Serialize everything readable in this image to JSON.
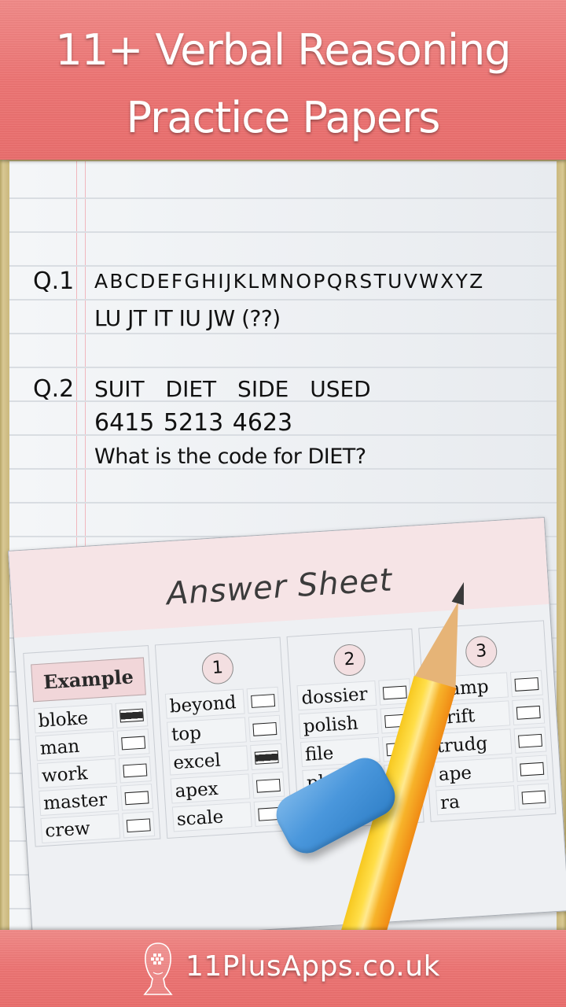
{
  "header": {
    "title_line1": "11+ Verbal Reasoning",
    "title_line2": "Practice Papers"
  },
  "questions": [
    {
      "label": "Q.1",
      "lines": [
        "ABCDEFGHIJKLMNOPQRSTUVWXYZ",
        "LU JT IT IU JW (??)"
      ]
    },
    {
      "label": "Q.2",
      "lines": [
        "SUIT DIET SIDE USED",
        "6415 5213 4623",
        "What is the code for DIET?"
      ]
    }
  ],
  "answer_sheet": {
    "title": "Answer Sheet",
    "columns": [
      {
        "header": "Example",
        "rows": [
          {
            "word": "bloke",
            "marked": true
          },
          {
            "word": "man",
            "marked": false
          },
          {
            "word": "work",
            "marked": false
          },
          {
            "word": "master",
            "marked": false
          },
          {
            "word": "crew",
            "marked": false
          }
        ]
      },
      {
        "header": "1",
        "rows": [
          {
            "word": "beyond",
            "marked": false
          },
          {
            "word": "top",
            "marked": false
          },
          {
            "word": "excel",
            "marked": true
          },
          {
            "word": "apex",
            "marked": false
          },
          {
            "word": "scale",
            "marked": false
          }
        ]
      },
      {
        "header": "2",
        "rows": [
          {
            "word": "dossier",
            "marked": false
          },
          {
            "word": "polish",
            "marked": false
          },
          {
            "word": "file",
            "marked": false
          },
          {
            "word": "pl",
            "marked": true
          },
          {
            "word": "",
            "marked": false
          }
        ]
      },
      {
        "header": "3",
        "rows": [
          {
            "word": "tramp",
            "marked": false
          },
          {
            "word": "drift",
            "marked": false
          },
          {
            "word": "trudg",
            "marked": false
          },
          {
            "word": "ape",
            "marked": false
          },
          {
            "word": "ra",
            "marked": false
          }
        ]
      }
    ]
  },
  "footer": {
    "logo_icon": "head-puzzle-icon",
    "website": "11PlusApps.co.uk"
  },
  "colors": {
    "banner": "#ec7473",
    "sheet_header": "#f6e4e6",
    "eraser": "#4a97dc",
    "pencil": "#f7c820"
  }
}
